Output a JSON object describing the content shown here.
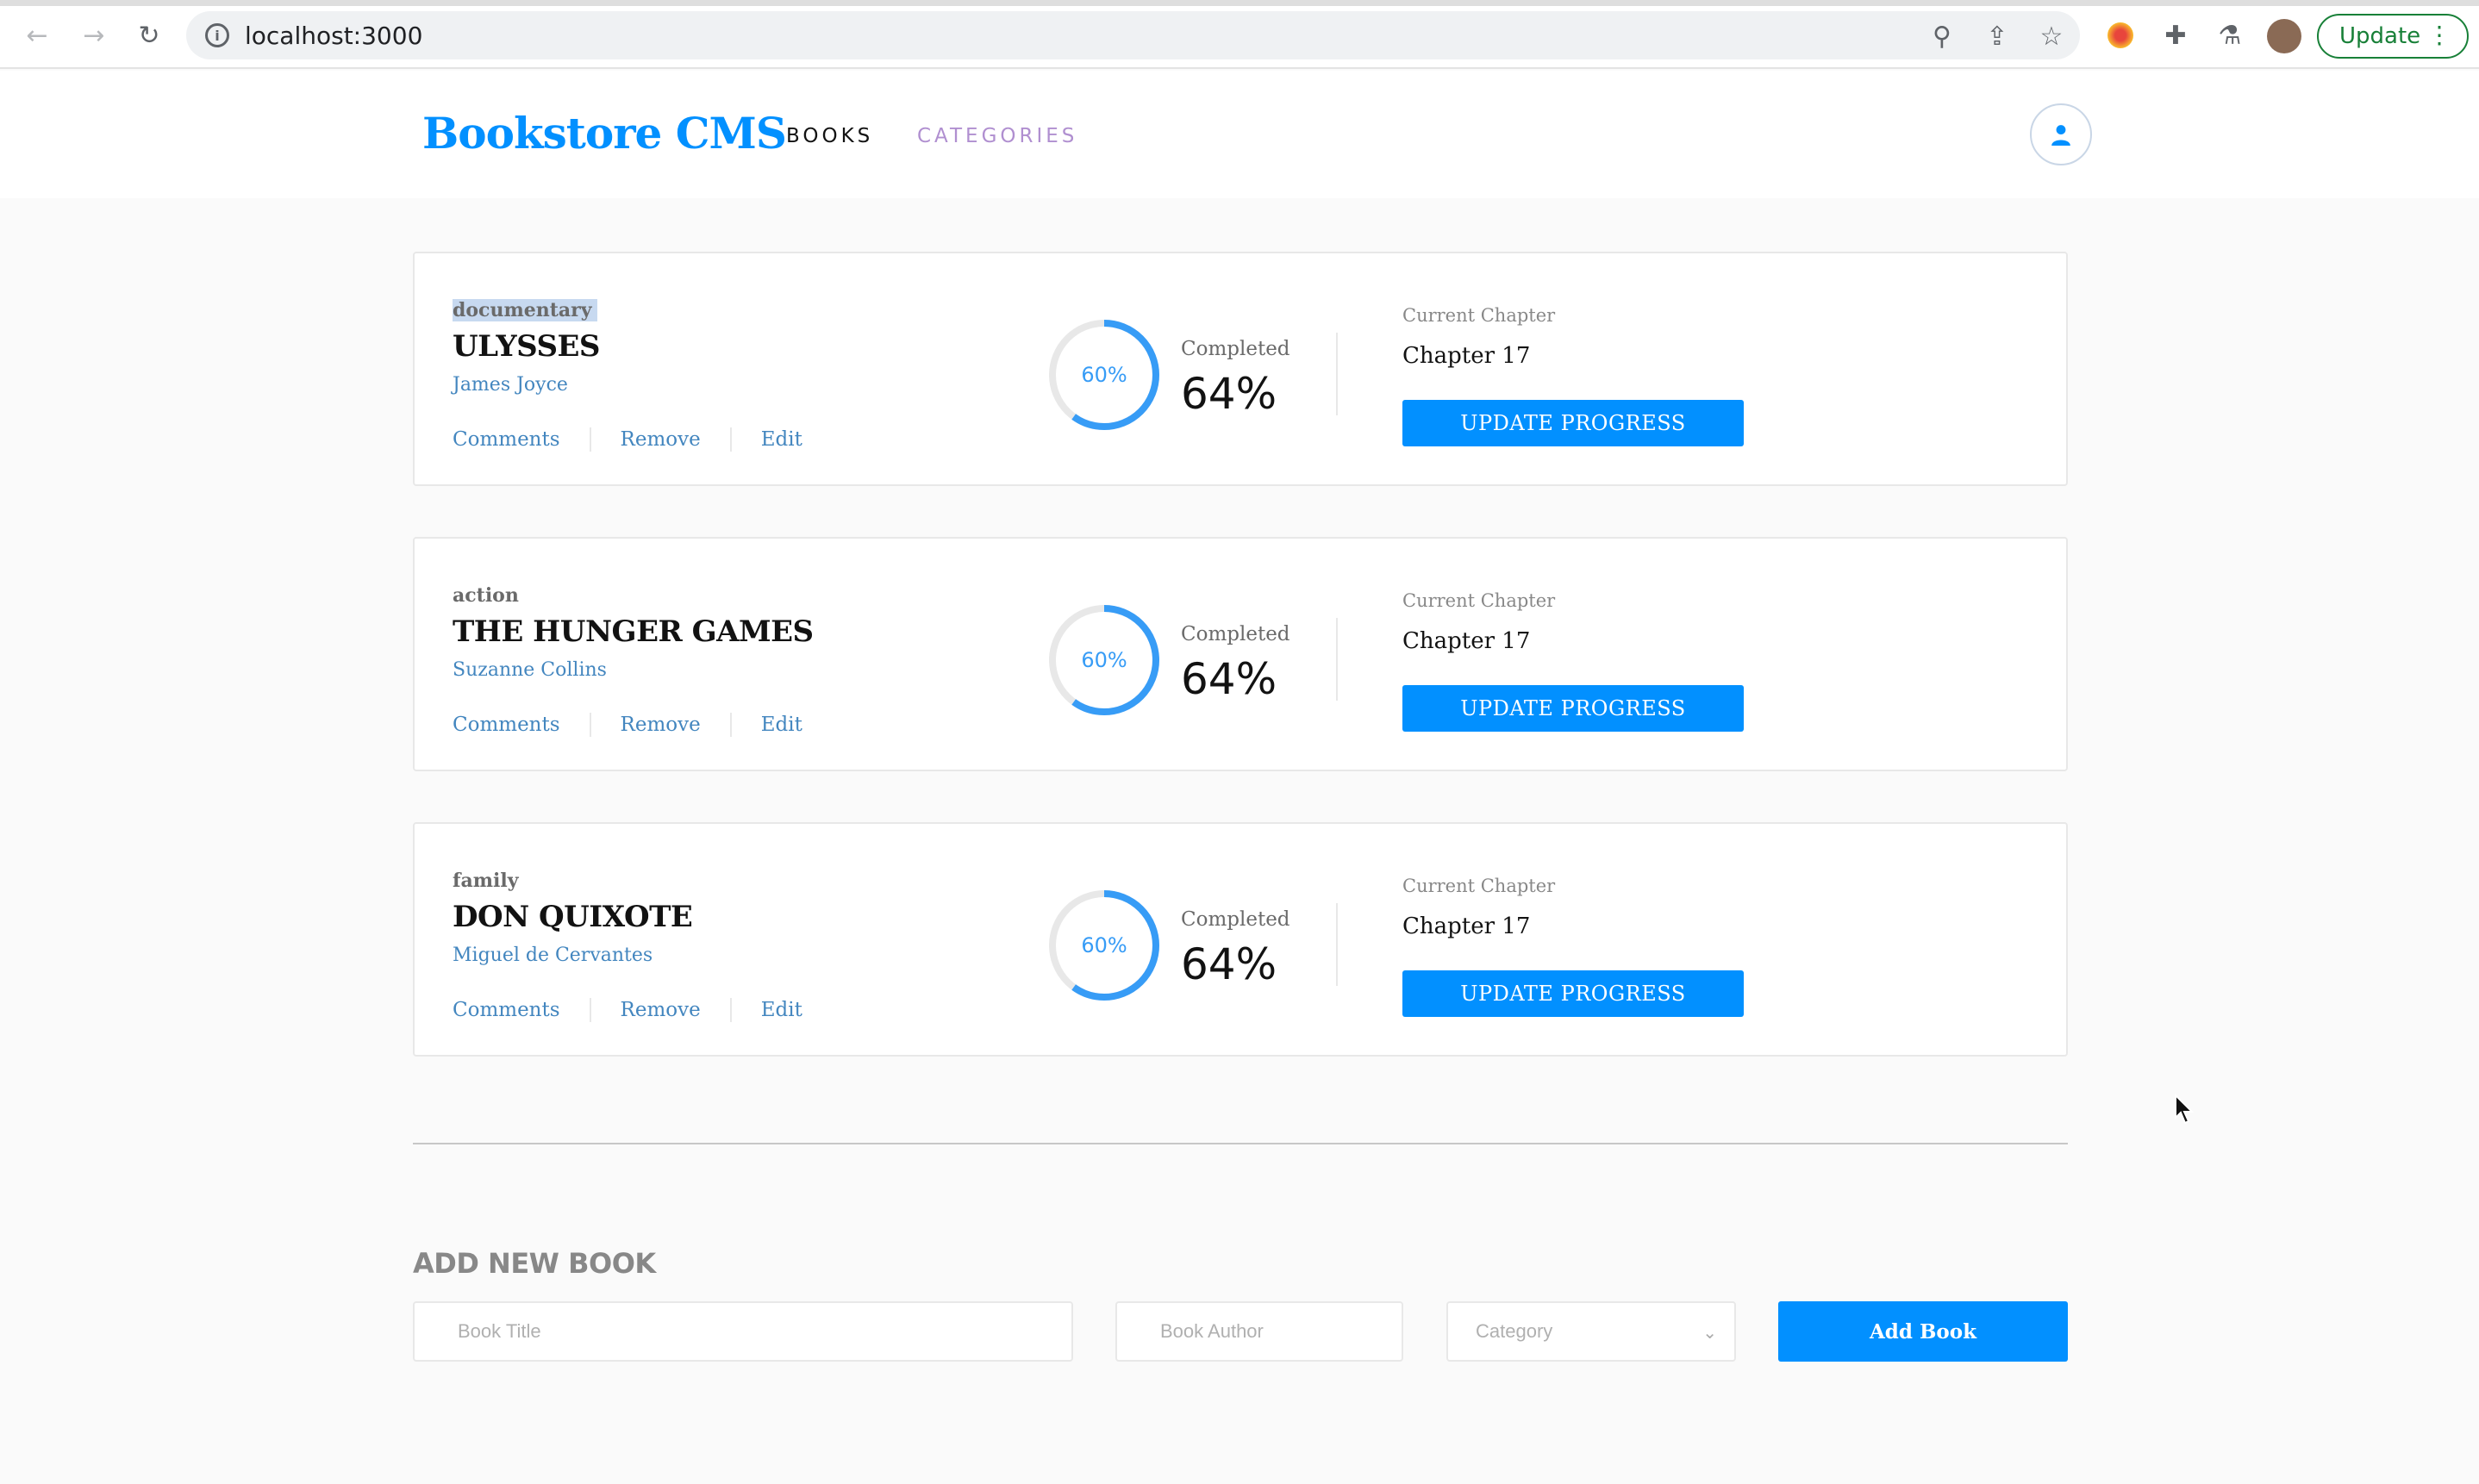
{
  "browser": {
    "url": "localhost:3000",
    "update_label": "Update",
    "nav_back_icon": "arrow-left-icon",
    "nav_forward_icon": "arrow-right-icon",
    "reload_icon": "reload-icon"
  },
  "header": {
    "logo": "Bookstore CMS",
    "nav": [
      {
        "label": "BOOKS",
        "active": true
      },
      {
        "label": "CATEGORIES",
        "active": false
      }
    ],
    "user_icon": "user-icon"
  },
  "books": [
    {
      "category": "documentary",
      "title": "ULYSSES",
      "author": "James Joyce",
      "actions": [
        "Comments",
        "Remove",
        "Edit"
      ],
      "ring_label": "60%",
      "ring_progress": 0.6,
      "completed_label": "Completed",
      "completed_value": "64%",
      "chapter_label": "Current Chapter",
      "chapter_value": "Chapter 17",
      "update_label": "UPDATE PROGRESS"
    },
    {
      "category": "action",
      "title": "THE HUNGER GAMES",
      "author": "Suzanne Collins",
      "actions": [
        "Comments",
        "Remove",
        "Edit"
      ],
      "ring_label": "60%",
      "ring_progress": 0.6,
      "completed_label": "Completed",
      "completed_value": "64%",
      "chapter_label": "Current Chapter",
      "chapter_value": "Chapter 17",
      "update_label": "UPDATE PROGRESS"
    },
    {
      "category": "family",
      "title": "DON QUIXOTE",
      "author": "Miguel de Cervantes",
      "actions": [
        "Comments",
        "Remove",
        "Edit"
      ],
      "ring_label": "60%",
      "ring_progress": 0.6,
      "completed_label": "Completed",
      "completed_value": "64%",
      "chapter_label": "Current Chapter",
      "chapter_value": "Chapter 17",
      "update_label": "UPDATE PROGRESS"
    }
  ],
  "add_book": {
    "heading": "ADD NEW BOOK",
    "title_placeholder": "Book Title",
    "author_placeholder": "Book Author",
    "category_placeholder": "Category",
    "submit_label": "Add Book"
  },
  "colors": {
    "brand": "#0290ff",
    "link": "#4386bf",
    "ring_progress": "#379cf6",
    "ring_track": "#e8e8e8",
    "nav_inactive": "#b08fd0"
  }
}
